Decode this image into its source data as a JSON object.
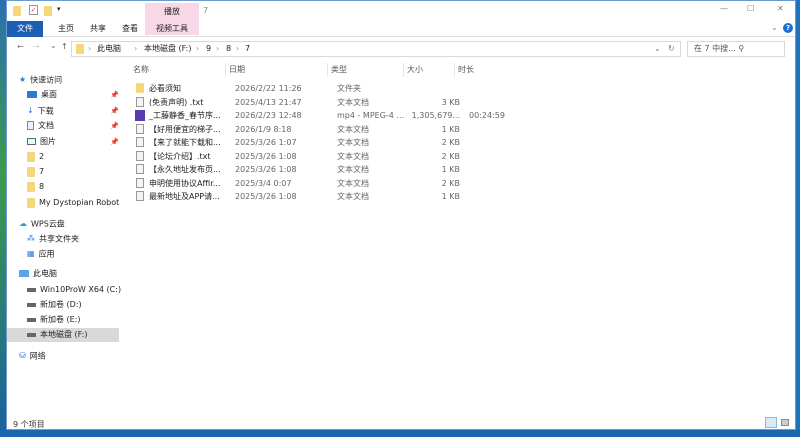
{
  "window": {
    "title": "7",
    "context_tab": "播放",
    "min": "—",
    "max": "☐",
    "close": "✕",
    "help": "?"
  },
  "ribbon": {
    "tabs": [
      "文件",
      "主页",
      "共享",
      "查看",
      "视频工具"
    ]
  },
  "nav": {
    "back": "←",
    "forward": "→",
    "recent": "⌄",
    "up": "↑",
    "refresh": "↻",
    "dropdown": "⌄"
  },
  "breadcrumb": [
    "此电脑",
    "本地磁盘 (F:)",
    "9",
    "8",
    "7"
  ],
  "search": {
    "placeholder": "在 7 中搜... ⚲"
  },
  "sidebar": [
    {
      "label": "快速访问",
      "icon": "star"
    },
    {
      "label": "桌面",
      "icon": "desktop",
      "pinned": true
    },
    {
      "label": "下载",
      "icon": "download",
      "pinned": true
    },
    {
      "label": "文档",
      "icon": "document",
      "pinned": true
    },
    {
      "label": "图片",
      "icon": "picture",
      "pinned": true
    },
    {
      "label": "2",
      "icon": "folder"
    },
    {
      "label": "7",
      "icon": "folder"
    },
    {
      "label": "8",
      "icon": "folder"
    },
    {
      "label": "My Dystopian Robot",
      "icon": "folder"
    },
    {
      "label": "WPS云盘",
      "icon": "cloud"
    },
    {
      "label": "共享文件夹",
      "icon": "share"
    },
    {
      "label": "应用",
      "icon": "apps"
    },
    {
      "label": "此电脑",
      "icon": "computer"
    },
    {
      "label": "Win10ProW X64 (C:)",
      "icon": "drive"
    },
    {
      "label": "新加卷 (D:)",
      "icon": "drive"
    },
    {
      "label": "新加卷 (E:)",
      "icon": "drive"
    },
    {
      "label": "本地磁盘 (F:)",
      "icon": "drive",
      "selected": true
    },
    {
      "label": "网络",
      "icon": "network"
    }
  ],
  "columns": [
    "名称",
    "日期",
    "类型",
    "大小",
    "时长"
  ],
  "files": [
    {
      "name": "必看须知",
      "date": "2026/2/22 11:26",
      "type": "文件夹",
      "size": "",
      "duration": "",
      "icon": "folder"
    },
    {
      "name": "(免责声明) .txt",
      "date": "2025/4/13 21:47",
      "type": "文本文档",
      "size": "3 KB",
      "duration": "",
      "icon": "txt"
    },
    {
      "name": "_工藤静香_春节序...",
      "date": "2026/2/23 12:48",
      "type": "mp4 - MPEG-4 ...",
      "size": "1,305,679...",
      "duration": "00:24:59",
      "icon": "video"
    },
    {
      "name": "【好用便宜的梯子...",
      "date": "2026/1/9 8:18",
      "type": "文本文档",
      "size": "1 KB",
      "duration": "",
      "icon": "txt"
    },
    {
      "name": "【来了就能下载和...",
      "date": "2025/3/26 1:07",
      "type": "文本文档",
      "size": "2 KB",
      "duration": "",
      "icon": "txt"
    },
    {
      "name": "【论坛介绍】.txt",
      "date": "2025/3/26 1:08",
      "type": "文本文档",
      "size": "2 KB",
      "duration": "",
      "icon": "txt"
    },
    {
      "name": "【永久地址发布页...",
      "date": "2025/3/26 1:08",
      "type": "文本文档",
      "size": "1 KB",
      "duration": "",
      "icon": "txt"
    },
    {
      "name": "申明使用协议Affir...",
      "date": "2025/3/4 0:07",
      "type": "文本文档",
      "size": "2 KB",
      "duration": "",
      "icon": "txt"
    },
    {
      "name": "最新地址及APP请...",
      "date": "2025/3/26 1:08",
      "type": "文本文档",
      "size": "1 KB",
      "duration": "",
      "icon": "txt"
    }
  ],
  "status": {
    "count": "9 个项目"
  }
}
